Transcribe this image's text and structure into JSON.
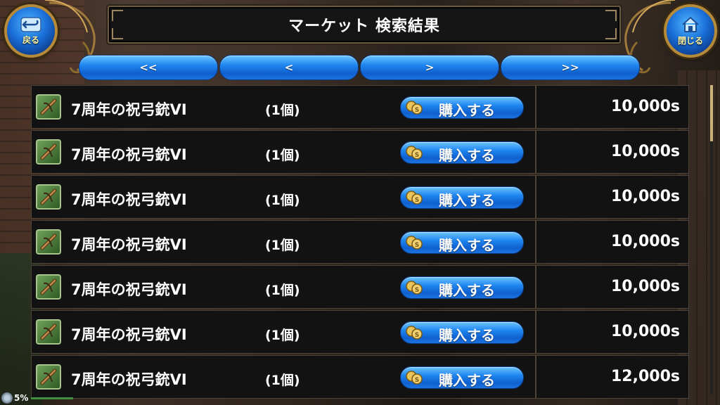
{
  "header": {
    "title": "マーケット 検索結果",
    "back_label": "戻る",
    "close_label": "閉じる"
  },
  "nav": {
    "first": "<<",
    "prev": "<",
    "next": ">",
    "last": ">>"
  },
  "rows": [
    {
      "name": "7周年の祝弓銃VI",
      "qty": "(1個)",
      "buy": "購入する",
      "price": "10,000s"
    },
    {
      "name": "7周年の祝弓銃VI",
      "qty": "(1個)",
      "buy": "購入する",
      "price": "10,000s"
    },
    {
      "name": "7周年の祝弓銃VI",
      "qty": "(1個)",
      "buy": "購入する",
      "price": "10,000s"
    },
    {
      "name": "7周年の祝弓銃VI",
      "qty": "(1個)",
      "buy": "購入する",
      "price": "10,000s"
    },
    {
      "name": "7周年の祝弓銃VI",
      "qty": "(1個)",
      "buy": "購入する",
      "price": "10,000s"
    },
    {
      "name": "7周年の祝弓銃VI",
      "qty": "(1個)",
      "buy": "購入する",
      "price": "10,000s"
    },
    {
      "name": "7周年の祝弓銃VI",
      "qty": "(1個)",
      "buy": "購入する",
      "price": "12,000s"
    }
  ],
  "status": {
    "percent": "5%",
    "icon": "gear-icon"
  },
  "colors": {
    "button_blue": "#1f86f0",
    "frame_gold": "#b58a3a",
    "row_bg": "#121212"
  }
}
